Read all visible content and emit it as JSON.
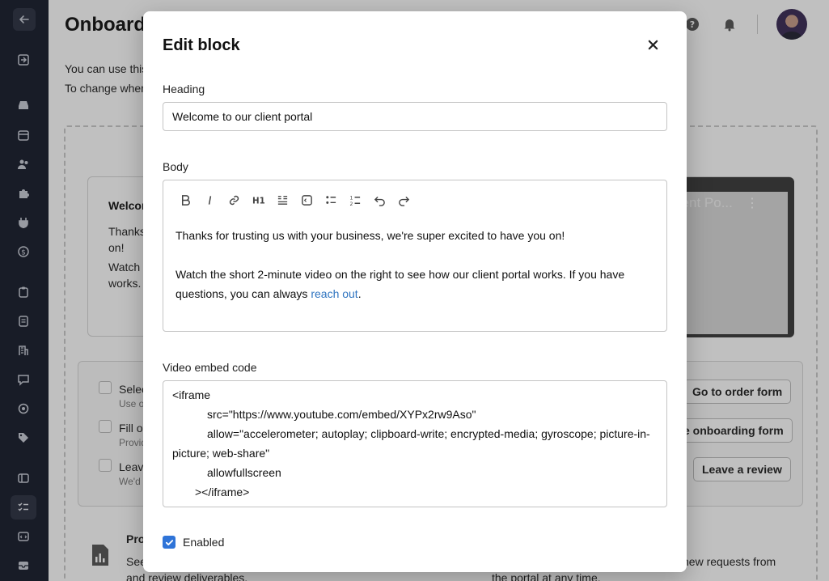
{
  "page": {
    "title": "Onboardi",
    "desc_line1": "You can use this",
    "desc_line2": "To change when"
  },
  "welcome_card": {
    "title": "Welcom",
    "text_line1": "Thanks",
    "text_line2": "on!",
    "text_line3": "Watch t",
    "text_line4": "works.",
    "video_title": "lient Po..."
  },
  "checklist": {
    "items": [
      {
        "label": "Selec",
        "sub": "Use o",
        "button": "Go to order form"
      },
      {
        "label": "Fill ou",
        "sub": "Provid",
        "button": "e onboarding form"
      },
      {
        "label": "Leave",
        "sub": "We'd l",
        "button": "Leave a review"
      }
    ]
  },
  "bottom": {
    "pro_label": "Pro",
    "left_line1": "See",
    "left_line2": "and review deliverables.",
    "right_line1": "new requests from",
    "right_line2": "the portal at any time."
  },
  "modal": {
    "title": "Edit block",
    "heading_label": "Heading",
    "heading_value": "Welcome to our client portal",
    "body_label": "Body",
    "body_p1": "Thanks for trusting us with your business, we're super excited to have you on!",
    "body_p2_line1": "Watch the short 2-minute video on the right to see how our client portal works. If you have",
    "body_p2_line2_pre": "questions, you can always ",
    "body_p2_link": "reach out",
    "body_p2_line2_post": ".",
    "video_label": "Video embed code",
    "code_lines": [
      "<iframe",
      "src=\"https://www.youtube.com/embed/XYPx2rw9Aso\"",
      "allow=\"accelerometer; autoplay; clipboard-write; encrypted-media; gyroscope; picture-in-",
      "picture; web-share\"",
      "allowfullscreen",
      "></iframe>"
    ],
    "enabled_label": "Enabled",
    "enabled_checked": true
  },
  "colors": {
    "sidebar_bg": "#171c2c",
    "accent": "#2f74d8",
    "link": "#2f74c0"
  }
}
